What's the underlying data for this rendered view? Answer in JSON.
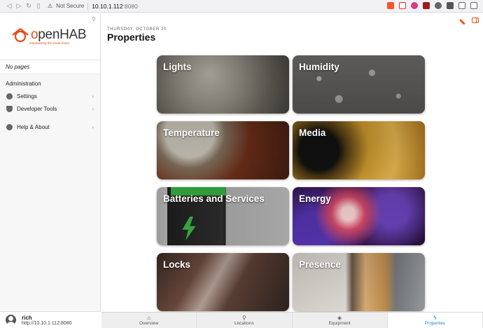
{
  "browser": {
    "url_warning": "Not Secure",
    "url_host": "10.10.1.112",
    "url_port": ":8080"
  },
  "sidebar": {
    "logo_text_prefix": "",
    "logo_text_o": "o",
    "logo_text_rest": "penHAB",
    "logo_tagline": "empowering the smart home",
    "no_pages": "No pages",
    "section_title": "Administration",
    "items": [
      {
        "label": "Settings",
        "icon": "gear-icon"
      },
      {
        "label": "Developer Tools",
        "icon": "shield-icon"
      },
      {
        "label": "Help & About",
        "icon": "question-icon"
      }
    ],
    "user_name": "rich",
    "user_url": "http://10.10.1.112:8080"
  },
  "main": {
    "date": "THURSDAY, OCTOBER 20",
    "title": "Properties",
    "cards": [
      {
        "label": "Lights"
      },
      {
        "label": "Humidity"
      },
      {
        "label": "Temperature"
      },
      {
        "label": "Media"
      },
      {
        "label": "Batteries and Services"
      },
      {
        "label": "Energy"
      },
      {
        "label": "Locks"
      },
      {
        "label": "Presence"
      }
    ]
  },
  "tabs": [
    {
      "label": "Overview",
      "icon": "home-icon",
      "active": false
    },
    {
      "label": "Locations",
      "icon": "location-pin-icon",
      "active": false
    },
    {
      "label": "Equipment",
      "icon": "cube-icon",
      "active": false
    },
    {
      "label": "Properties",
      "icon": "bolt-icon",
      "active": true
    }
  ],
  "colors": {
    "accent": "#e64a19",
    "active_tab": "#1e88e5"
  }
}
